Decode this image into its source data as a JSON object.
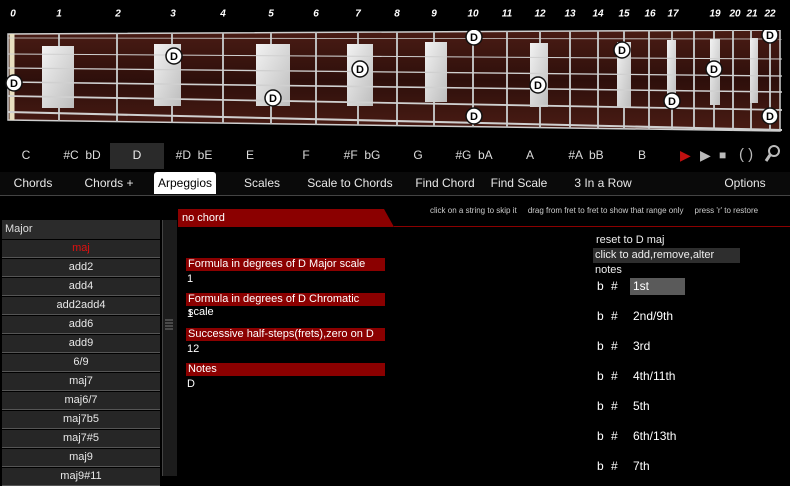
{
  "fret_numbers": [
    "0",
    "1",
    "2",
    "3",
    "4",
    "5",
    "6",
    "7",
    "8",
    "9",
    "10",
    "11",
    "12",
    "13",
    "14",
    "15",
    "16",
    "17",
    "19",
    "20",
    "21",
    "22"
  ],
  "fret_marker_note": "D",
  "note_bar": {
    "notes": [
      "C",
      "#C  bD",
      "D",
      "#D  bE",
      "E",
      "F",
      "#F  bG",
      "G",
      "#G  bA",
      "A",
      "#A  bB",
      "B"
    ],
    "selected_index": 2,
    "controls": {
      "record": "record-icon",
      "play": "play-icon",
      "stop": "stop-icon",
      "loop": "loop-icon",
      "zoom": "magnifier-icon"
    }
  },
  "tabs": [
    "Chords",
    "Chords +",
    "Arpeggios",
    "Scales",
    "Scale to Chords",
    "Find Chord",
    "Find Scale",
    "3 In a Row",
    "Options"
  ],
  "active_tab": "Arpeggios",
  "hint": "click on a string to skip it     drag from fret to fret to show that range only     press 'r' to restore",
  "chord_list": {
    "heading": "Major",
    "items": [
      "maj",
      "add2",
      "add4",
      "add2add4",
      "add6",
      "add9",
      "6/9",
      "maj7",
      "maj6/7",
      "maj7b5",
      "maj7#5",
      "maj9",
      "maj9#11"
    ],
    "selected": "maj"
  },
  "panel": {
    "title": "no chord",
    "sections": [
      {
        "label": "Formula in degrees of D Major scale",
        "value": "1"
      },
      {
        "label": "Formula in degrees of D Chromatic scale",
        "value": "1"
      },
      {
        "label": "Successive half-steps(frets),zero on D",
        "value": "12"
      },
      {
        "label": "Notes",
        "value": "D"
      }
    ],
    "reset_label": "reset to D maj",
    "add_label": "click to add,remove,alter notes",
    "flat_label": "b",
    "sharp_label": "#",
    "degrees": [
      "1st",
      "2nd/9th",
      "3rd",
      "4th/11th",
      "5th",
      "6th/13th",
      "7th"
    ],
    "selected_degree": "1st"
  },
  "colors": {
    "accent_red": "#8b0000",
    "selected_red": "#e01010",
    "fretboard": "#3a1410"
  }
}
